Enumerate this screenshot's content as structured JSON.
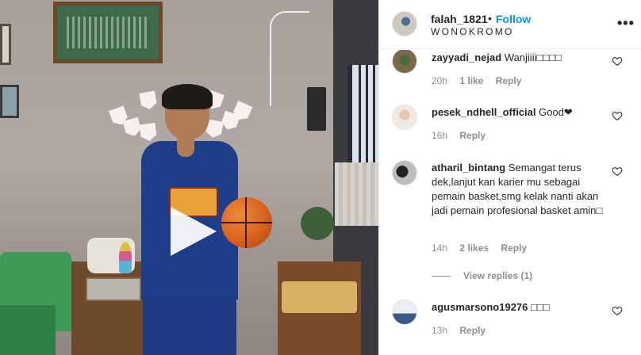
{
  "header": {
    "username": "falah_1821",
    "separator": "•",
    "follow_label": "Follow",
    "location": "WONOKROMO",
    "more_icon": "more-options-icon"
  },
  "media": {
    "play_icon": "play-icon"
  },
  "comments": [
    {
      "username": "zayyadi_nejad",
      "text": "Wanjiiii□□□□",
      "time": "20h",
      "likes": "1 like",
      "reply": "Reply"
    },
    {
      "username": "pesek_ndhell_official",
      "text": "Good❤",
      "time": "16h",
      "likes": "",
      "reply": "Reply"
    },
    {
      "username": "atharil_bintang",
      "text": "Semangat terus dek,lanjut kan karier mu sebagai pemain basket,smg kelak nanti akan jadi pemain profesional basket amin□",
      "time": "14h",
      "likes": "2 likes",
      "reply": "Reply"
    },
    {
      "username": "agusmarsono19276",
      "text": "□□□",
      "time": "13h",
      "likes": "",
      "reply": "Reply"
    }
  ],
  "view_replies_label": "View replies (1)",
  "colors": {
    "accent": "#0095f6",
    "text": "#262626",
    "muted": "#8e8e8e"
  }
}
